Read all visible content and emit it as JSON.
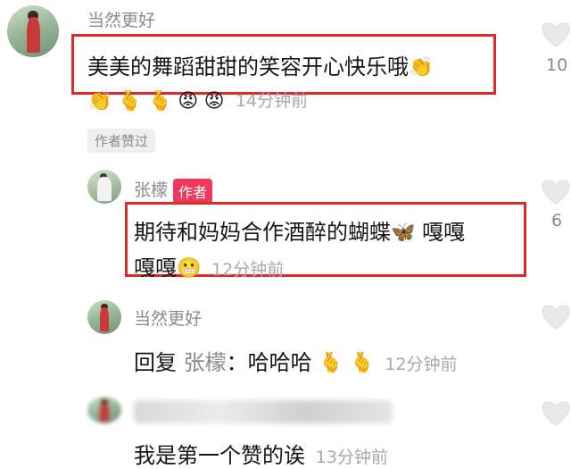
{
  "comments": [
    {
      "user": "当然更好",
      "text": "美美的舞蹈甜甜的笑容开心快乐哦",
      "text_emoji": "👏",
      "reactions": [
        "👏",
        "🫰",
        "🫰",
        "😡",
        "😡"
      ],
      "time": "14分钟前",
      "liked_by_author": "作者赞过",
      "like_count": "10"
    },
    {
      "user": "张檬",
      "author_badge": "作者",
      "text_line1": "期待和妈妈合作酒醉的蝴蝶",
      "text_line1_emoji": "🦋",
      "text_line1_end": "嘎嘎",
      "text_line2": "嘎嘎",
      "text_line2_emoji": "😬",
      "time": "12分钟前",
      "like_count": "6"
    },
    {
      "user": "当然更好",
      "reply_label": "回复",
      "reply_to": "张檬",
      "reply_sep": "：",
      "text": "哈哈哈",
      "reactions": [
        "🫰",
        "🫰"
      ],
      "time": "12分钟前"
    },
    {
      "text": "我是第一个赞的诶",
      "time": "13分钟前"
    }
  ],
  "colors": {
    "highlight_border": "#e0282b",
    "author_badge_bg": "#f0385a",
    "name": "#8a8a8a",
    "time": "#a8a8a8"
  },
  "icons": [
    "heart-outline-icon"
  ]
}
